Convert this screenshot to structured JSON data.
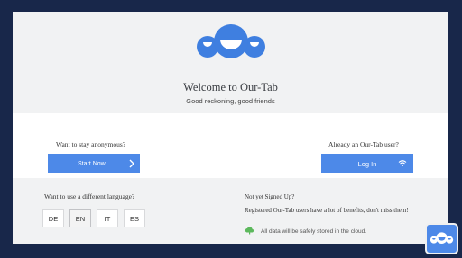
{
  "welcome": {
    "title": "Welcome to Our-Tab",
    "tagline": "Good reckoning, good friends"
  },
  "anonymous": {
    "question": "Want to stay anonymous?",
    "button_label": "Start Now",
    "button_icon": "chevron-right-icon"
  },
  "existing_user": {
    "question": "Already an Our-Tab user?",
    "button_label": "Log In",
    "button_icon": "wifi-icon"
  },
  "language": {
    "question": "Want to use a different language?",
    "options": [
      "DE",
      "EN",
      "IT",
      "ES"
    ],
    "selected": "EN"
  },
  "signup": {
    "heading": "Not yet Signed Up?",
    "benefits": "Registered Our-Tab users have a lot of benefits, don't miss them!",
    "cloud_note": "All data will be safely stored in the cloud.",
    "cloud_icon": "cloud-icon"
  },
  "colors": {
    "accent": "#4d89e8",
    "background": "#18274a",
    "panel": "#f1f2f3",
    "cloud": "#5cb85c"
  }
}
